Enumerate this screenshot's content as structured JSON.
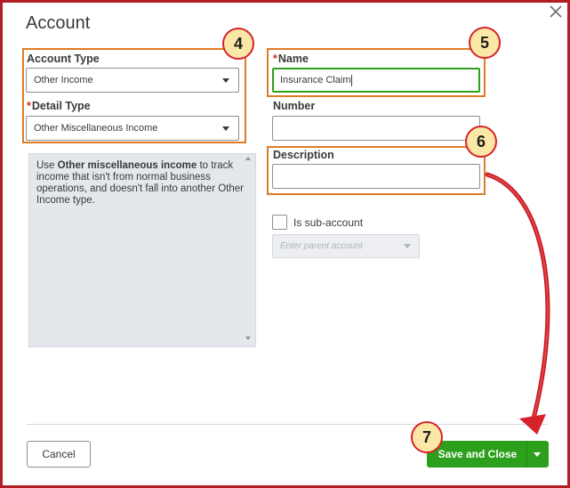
{
  "dialog": {
    "title": "Account"
  },
  "account_type": {
    "label": "Account Type",
    "value": "Other Income"
  },
  "detail_type": {
    "required_marker": "*",
    "label": "Detail Type",
    "value": "Other Miscellaneous Income"
  },
  "name": {
    "required_marker": "*",
    "label": "Name",
    "value": "Insurance Claim"
  },
  "number": {
    "label": "Number",
    "value": ""
  },
  "description": {
    "label": "Description",
    "value": ""
  },
  "info_text": {
    "prefix": "Use ",
    "bold": "Other miscellaneous income",
    "suffix": " to track income that isn't from normal business operations, and doesn't fall into another Other Income type."
  },
  "sub_account": {
    "label": "Is sub-account",
    "checked": false,
    "parent_placeholder": "Enter parent account"
  },
  "footer": {
    "cancel_label": "Cancel",
    "save_label": "Save and Close"
  },
  "annotations": {
    "step_4": "4",
    "step_5": "5",
    "step_6": "6",
    "step_7": "7"
  },
  "colors": {
    "primary_green": "#2ca01c",
    "annotation_orange": "#e07b27",
    "frame_red": "#b01e23",
    "arrow_red": "#d6222a",
    "badge_fill": "#fbe8a6"
  },
  "icons": {
    "close": "close-icon",
    "dropdown": "chevron-down-icon"
  }
}
